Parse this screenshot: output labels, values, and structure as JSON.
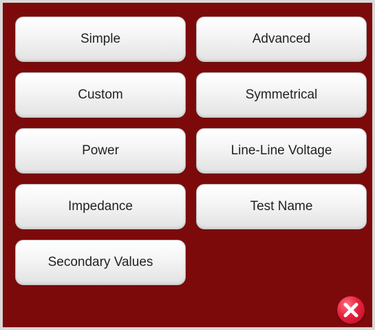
{
  "buttons": {
    "simple": "Simple",
    "advanced": "Advanced",
    "custom": "Custom",
    "symmetrical": "Symmetrical",
    "power": "Power",
    "line_line_voltage": "Line-Line Voltage",
    "impedance": "Impedance",
    "test_name": "Test Name",
    "secondary_values": "Secondary Values"
  },
  "icons": {
    "close": "close-icon"
  },
  "colors": {
    "panel_background": "#7d0a0a",
    "button_face": "#f4f4f4",
    "close_accent": "#e8203c"
  }
}
